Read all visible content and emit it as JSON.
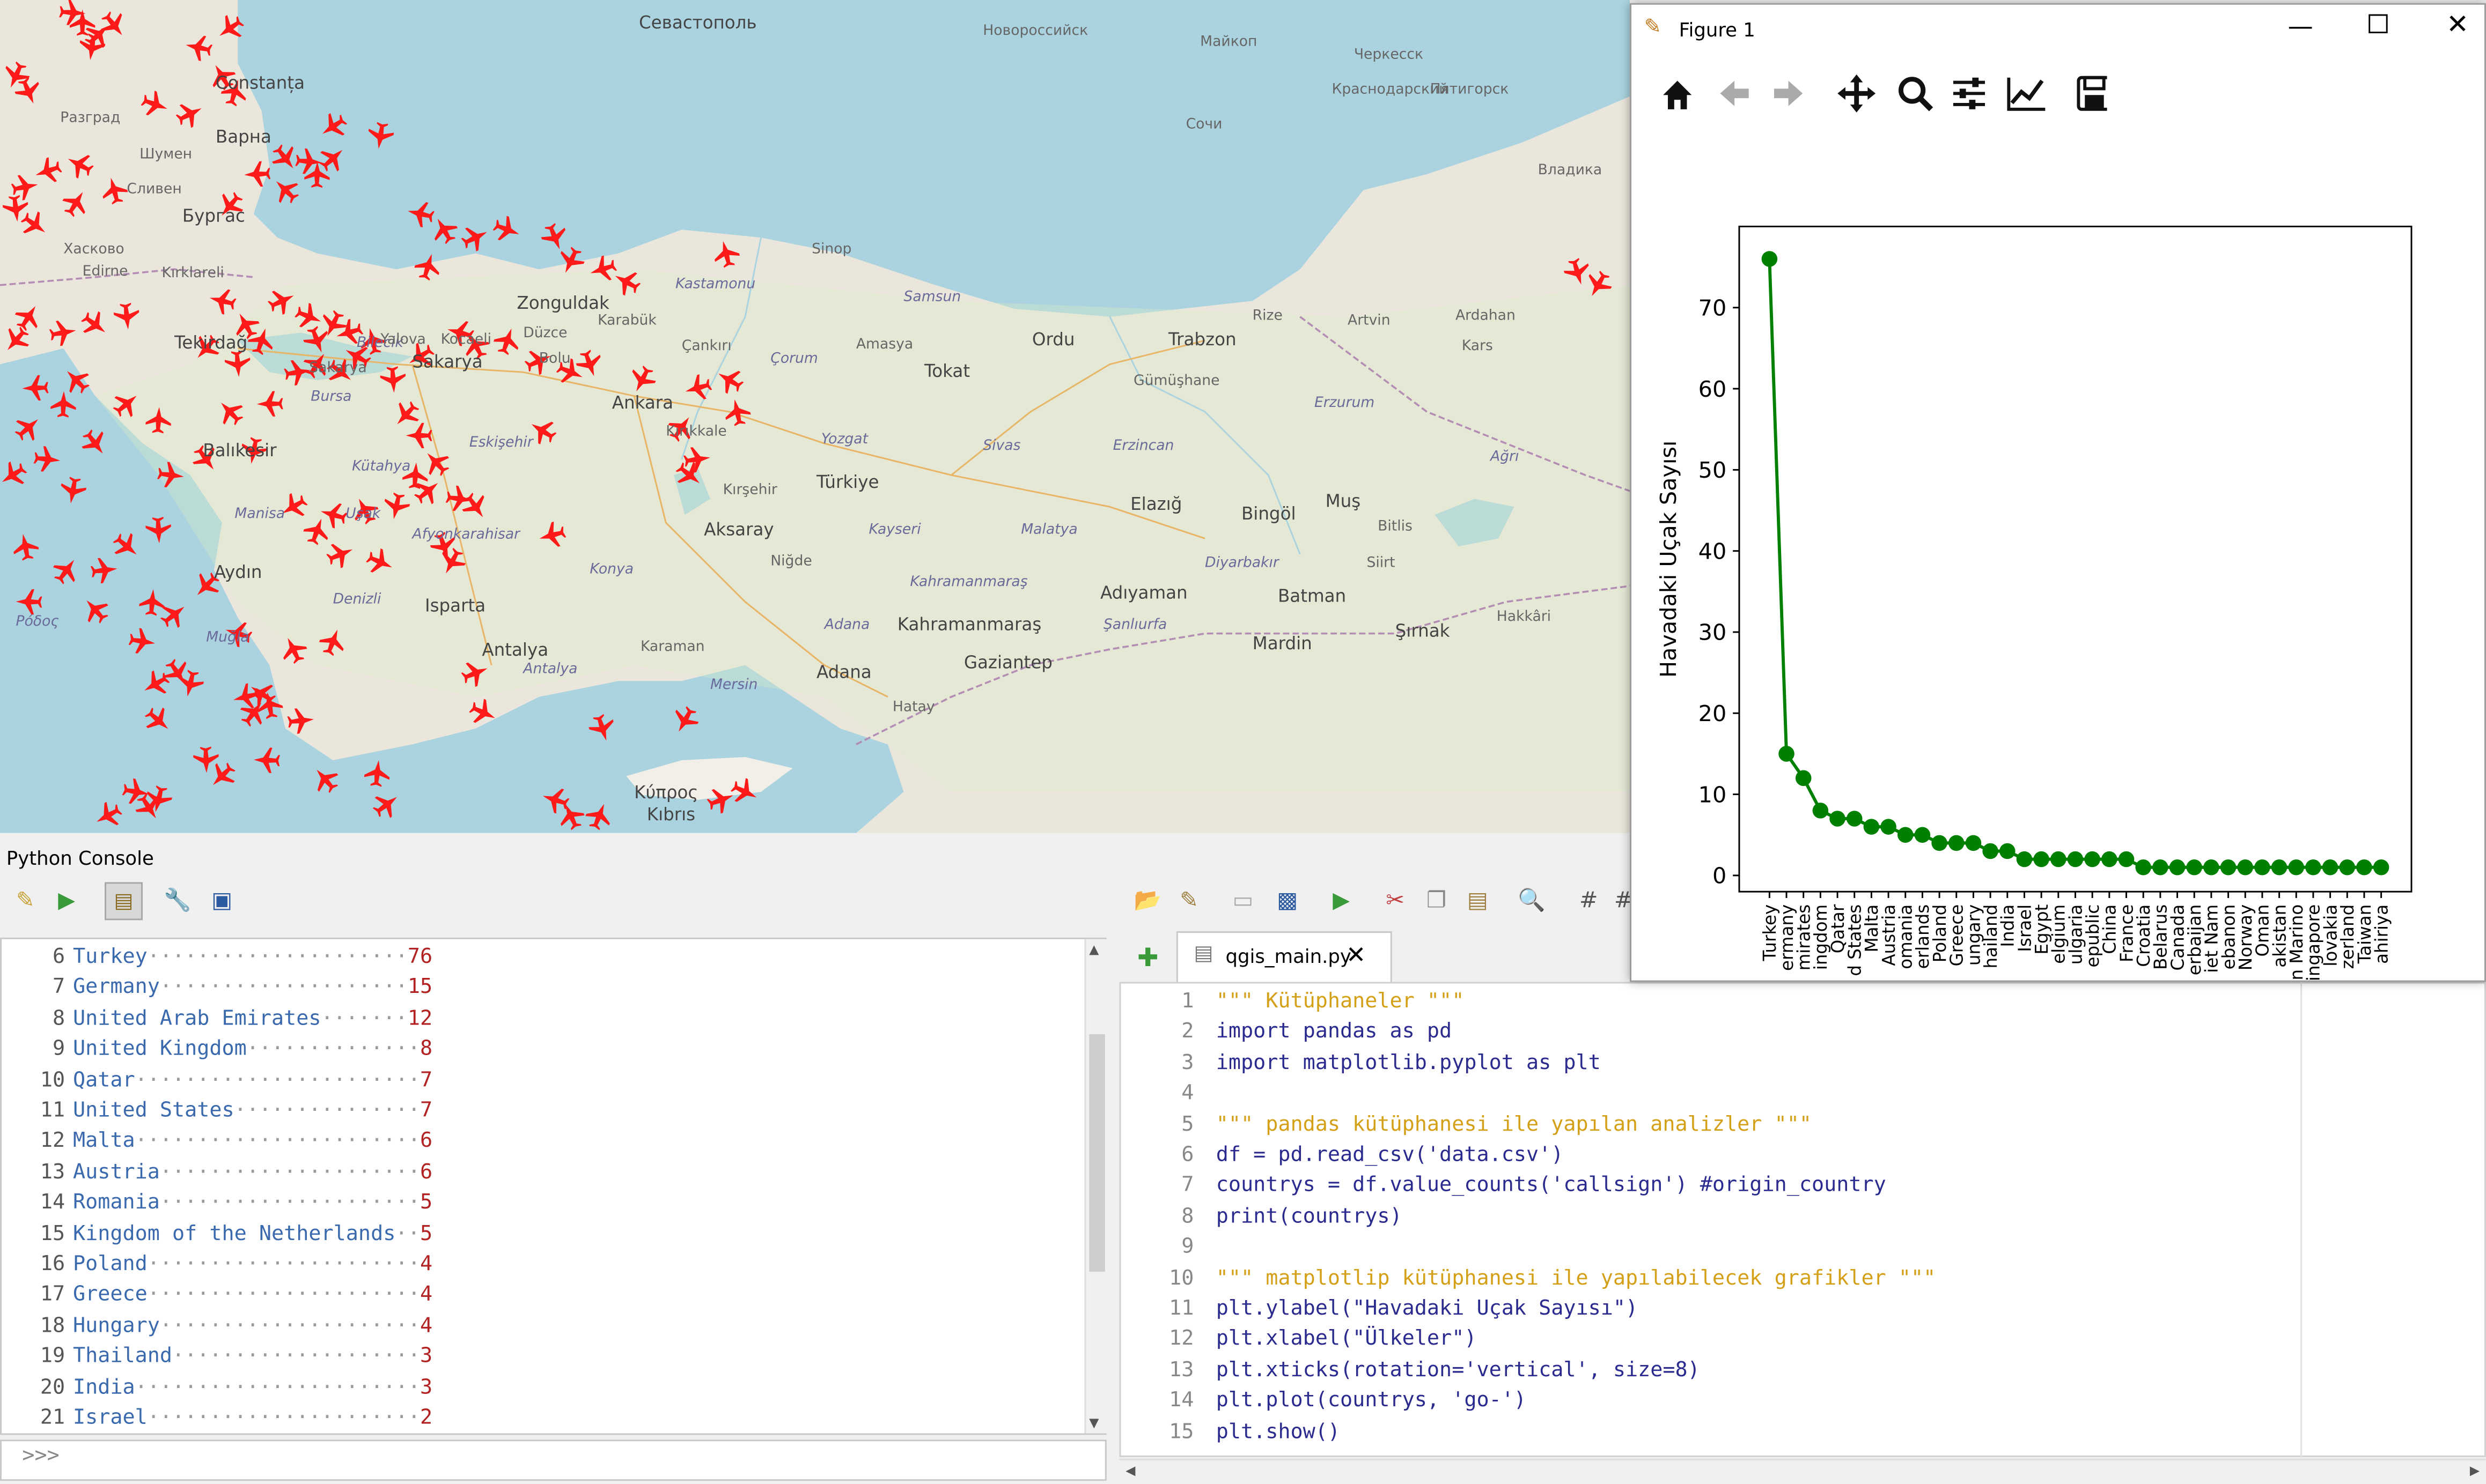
{
  "map": {
    "cities": [
      {
        "name": "Севастополь",
        "cls": ""
      },
      {
        "name": "Новороссийск",
        "cls": "small"
      },
      {
        "name": "Майкоп",
        "cls": "small"
      },
      {
        "name": "Черкесск",
        "cls": "small"
      },
      {
        "name": "Краснодарский",
        "cls": "small"
      },
      {
        "name": "Пятигорск",
        "cls": "small"
      },
      {
        "name": "Сочи",
        "cls": "small"
      },
      {
        "name": "Владика",
        "cls": "small"
      },
      {
        "name": "Constanța",
        "cls": ""
      },
      {
        "name": "Варна",
        "cls": ""
      },
      {
        "name": "Бургас",
        "cls": ""
      },
      {
        "name": "Разград",
        "cls": "small"
      },
      {
        "name": "Шумен",
        "cls": "small"
      },
      {
        "name": "Сливен",
        "cls": "small"
      },
      {
        "name": "Хасково",
        "cls": "small"
      },
      {
        "name": "Edirne",
        "cls": "small"
      },
      {
        "name": "Kırklareli",
        "cls": "small"
      },
      {
        "name": "Tekirdağ",
        "cls": ""
      },
      {
        "name": "Sinop",
        "cls": "small"
      },
      {
        "name": "Samsun",
        "cls": "italic"
      },
      {
        "name": "Zonguldak",
        "cls": ""
      },
      {
        "name": "Karabük",
        "cls": "small"
      },
      {
        "name": "Kastamonu",
        "cls": "italic"
      },
      {
        "name": "Ordu",
        "cls": ""
      },
      {
        "name": "Trabzon",
        "cls": ""
      },
      {
        "name": "Rize",
        "cls": "small"
      },
      {
        "name": "Artvin",
        "cls": "small"
      },
      {
        "name": "Ardahan",
        "cls": "small"
      },
      {
        "name": "Kars",
        "cls": "small"
      },
      {
        "name": "Amasya",
        "cls": "small"
      },
      {
        "name": "Tokat",
        "cls": ""
      },
      {
        "name": "Çorum",
        "cls": "italic"
      },
      {
        "name": "Çankırı",
        "cls": "small"
      },
      {
        "name": "Gümüşhane",
        "cls": "small"
      },
      {
        "name": "Erzurum",
        "cls": "italic"
      },
      {
        "name": "Ankara",
        "cls": ""
      },
      {
        "name": "Kırıkkale",
        "cls": "small"
      },
      {
        "name": "Yozgat",
        "cls": "italic"
      },
      {
        "name": "Sivas",
        "cls": "italic"
      },
      {
        "name": "Erzincan",
        "cls": "italic"
      },
      {
        "name": "Ağrı",
        "cls": "italic"
      },
      {
        "name": "Sakarya",
        "cls": ""
      },
      {
        "name": "Bursa",
        "cls": "italic"
      },
      {
        "name": "Balıkesir",
        "cls": ""
      },
      {
        "name": "Eskişehir",
        "cls": "italic"
      },
      {
        "name": "Kütahya",
        "cls": "italic"
      },
      {
        "name": "Kırşehir",
        "cls": "small"
      },
      {
        "name": "Türkiye",
        "cls": ""
      },
      {
        "name": "Elazığ",
        "cls": ""
      },
      {
        "name": "Bingöl",
        "cls": ""
      },
      {
        "name": "Muş",
        "cls": ""
      },
      {
        "name": "Bitlis",
        "cls": "small"
      },
      {
        "name": "Manisa",
        "cls": "italic"
      },
      {
        "name": "Uşak",
        "cls": "italic"
      },
      {
        "name": "Afyonkarahisar",
        "cls": "italic"
      },
      {
        "name": "Aksaray",
        "cls": ""
      },
      {
        "name": "Kayseri",
        "cls": "italic"
      },
      {
        "name": "Malatya",
        "cls": "italic"
      },
      {
        "name": "Niğde",
        "cls": "small"
      },
      {
        "name": "Diyarbakır",
        "cls": "italic"
      },
      {
        "name": "Siirt",
        "cls": "small"
      },
      {
        "name": "Aydın",
        "cls": ""
      },
      {
        "name": "Konya",
        "cls": "italic"
      },
      {
        "name": "Kahramanmaraş",
        "cls": "italic"
      },
      {
        "name": "Adıyaman",
        "cls": ""
      },
      {
        "name": "Batman",
        "cls": ""
      },
      {
        "name": "Denizli",
        "cls": "italic"
      },
      {
        "name": "Isparta",
        "cls": ""
      },
      {
        "name": "Adana",
        "cls": "italic"
      },
      {
        "name": "Kahramanmaraş",
        "cls": ""
      },
      {
        "name": "Şanlıurfa",
        "cls": "italic"
      },
      {
        "name": "Mardin",
        "cls": ""
      },
      {
        "name": "Şırnak",
        "cls": ""
      },
      {
        "name": "Hakkâri",
        "cls": "small"
      },
      {
        "name": "Antalya",
        "cls": ""
      },
      {
        "name": "Karaman",
        "cls": "small"
      },
      {
        "name": "Mersin",
        "cls": "italic"
      },
      {
        "name": "Adana",
        "cls": ""
      },
      {
        "name": "Gaziantep",
        "cls": ""
      },
      {
        "name": "Hatay",
        "cls": "small"
      },
      {
        "name": "Muğla",
        "cls": "italic"
      },
      {
        "name": "Antalya",
        "cls": "italic"
      },
      {
        "name": "Κύπρος",
        "cls": ""
      },
      {
        "name": "Kıbrıs",
        "cls": ""
      },
      {
        "name": "Ρόδος",
        "cls": "italic"
      },
      {
        "name": "Sakarya",
        "cls": "small"
      },
      {
        "name": "Bilecik",
        "cls": "italic"
      },
      {
        "name": "Düzce",
        "cls": "small"
      },
      {
        "name": "Bolu",
        "cls": "small"
      },
      {
        "name": "Yalova",
        "cls": "small"
      },
      {
        "name": "Kocaeli",
        "cls": "small"
      }
    ]
  },
  "console": {
    "title": "Python Console",
    "prompt": ">>>",
    "rows": [
      {
        "n": "6",
        "name": "Turkey",
        "value": "76"
      },
      {
        "n": "7",
        "name": "Germany",
        "value": "15"
      },
      {
        "n": "8",
        "name": "United Arab Emirates",
        "value": "12"
      },
      {
        "n": "9",
        "name": "United Kingdom",
        "value": "8"
      },
      {
        "n": "10",
        "name": "Qatar",
        "value": "7"
      },
      {
        "n": "11",
        "name": "United States",
        "value": "7"
      },
      {
        "n": "12",
        "name": "Malta",
        "value": "6"
      },
      {
        "n": "13",
        "name": "Austria",
        "value": "6"
      },
      {
        "n": "14",
        "name": "Romania",
        "value": "5"
      },
      {
        "n": "15",
        "name": "Kingdom of the Netherlands",
        "value": "5"
      },
      {
        "n": "16",
        "name": "Poland",
        "value": "4"
      },
      {
        "n": "17",
        "name": "Greece",
        "value": "4"
      },
      {
        "n": "18",
        "name": "Hungary",
        "value": "4"
      },
      {
        "n": "19",
        "name": "Thailand",
        "value": "3"
      },
      {
        "n": "20",
        "name": "India",
        "value": "3"
      },
      {
        "n": "21",
        "name": "Israel",
        "value": "2"
      }
    ]
  },
  "editor": {
    "tab_label": "qgis_main.py",
    "lines": [
      {
        "n": "1",
        "text": "\"\"\" Kütüphaneler \"\"\"",
        "kind": "str"
      },
      {
        "n": "2",
        "text": "import pandas as pd",
        "kind": "code"
      },
      {
        "n": "3",
        "text": "import matplotlib.pyplot as plt",
        "kind": "code"
      },
      {
        "n": "4",
        "text": "",
        "kind": "code"
      },
      {
        "n": "5",
        "text": "\"\"\" pandas kütüphanesi ile yapılan analizler \"\"\"",
        "kind": "str"
      },
      {
        "n": "6",
        "text": "df = pd.read_csv('data.csv')",
        "kind": "code"
      },
      {
        "n": "7",
        "text": "countrys = df.value_counts('callsign') #origin_country",
        "kind": "code"
      },
      {
        "n": "8",
        "text": "print(countrys)",
        "kind": "code"
      },
      {
        "n": "9",
        "text": "",
        "kind": "code"
      },
      {
        "n": "10",
        "text": "\"\"\" matplotlip kütüphanesi ile yapılabilecek grafikler \"\"\"",
        "kind": "str"
      },
      {
        "n": "11",
        "text": "plt.ylabel(\"Havadaki Uçak Sayısı\")",
        "kind": "code"
      },
      {
        "n": "12",
        "text": "plt.xlabel(\"Ülkeler\")",
        "kind": "code"
      },
      {
        "n": "13",
        "text": "plt.xticks(rotation='vertical', size=8)",
        "kind": "code"
      },
      {
        "n": "14",
        "text": "plt.plot(countrys, 'go-')",
        "kind": "code"
      },
      {
        "n": "15",
        "text": "plt.show()",
        "kind": "code"
      }
    ]
  },
  "figure": {
    "title": "Figure 1",
    "colors": {
      "line": "#008000"
    },
    "icons": [
      "home-icon",
      "back-icon",
      "forward-icon",
      "pan-icon",
      "zoom-icon",
      "configure-subplots-icon",
      "edit-axes-icon",
      "save-icon"
    ]
  },
  "chart_data": {
    "type": "line",
    "ylabel": "Havadaki Uçak Sayısı",
    "xlabel": "",
    "ylim": [
      -2,
      80
    ],
    "yticks": [
      0,
      10,
      20,
      30,
      40,
      50,
      60,
      70
    ],
    "categories": [
      "Turkey",
      "ermany",
      "mirates",
      "ingdom",
      "Qatar",
      "d States",
      "Malta",
      "Austria",
      "omania",
      "erlands",
      "Poland",
      "Greece",
      "ungary",
      "hailand",
      "India",
      "Israel",
      "Egypt",
      "elgium",
      "ulgaria",
      "epublic",
      "China",
      "France",
      "Croatia",
      "Belarus",
      "Canada",
      "erbaijan",
      "iet Nam",
      "ebanon",
      "Norway",
      "Oman",
      "akistan",
      "n Marino",
      "ingapore",
      "lovakia",
      "zerland",
      "Taiwan",
      "ahiriya"
    ],
    "values": [
      76,
      15,
      12,
      8,
      7,
      7,
      6,
      6,
      5,
      5,
      4,
      4,
      4,
      3,
      3,
      2,
      2,
      2,
      2,
      2,
      2,
      2,
      1,
      1,
      1,
      1,
      1,
      1,
      1,
      1,
      1,
      1,
      1,
      1,
      1,
      1,
      1
    ]
  }
}
